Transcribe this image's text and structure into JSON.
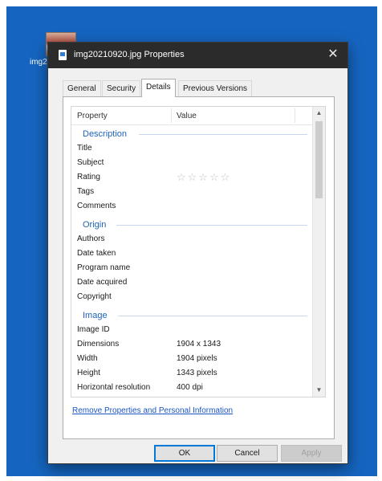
{
  "desktop": {
    "icon_label": "img2"
  },
  "dialog": {
    "title": "img20210920.jpg Properties",
    "close_glyph": "✕"
  },
  "tabs": [
    {
      "label": "General"
    },
    {
      "label": "Security"
    },
    {
      "label": "Details",
      "active": true
    },
    {
      "label": "Previous Versions"
    }
  ],
  "details": {
    "columns": {
      "property": "Property",
      "value": "Value"
    },
    "groups": {
      "description": "Description",
      "origin": "Origin",
      "image": "Image"
    },
    "description_rows": [
      {
        "property": "Title",
        "value": ""
      },
      {
        "property": "Subject",
        "value": ""
      },
      {
        "property": "Rating",
        "value": "☆☆☆☆☆"
      },
      {
        "property": "Tags",
        "value": ""
      },
      {
        "property": "Comments",
        "value": ""
      }
    ],
    "origin_rows": [
      {
        "property": "Authors",
        "value": ""
      },
      {
        "property": "Date taken",
        "value": ""
      },
      {
        "property": "Program name",
        "value": ""
      },
      {
        "property": "Date acquired",
        "value": ""
      },
      {
        "property": "Copyright",
        "value": ""
      }
    ],
    "image_rows": [
      {
        "property": "Image ID",
        "value": ""
      },
      {
        "property": "Dimensions",
        "value": "1904 x 1343"
      },
      {
        "property": "Width",
        "value": "1904 pixels"
      },
      {
        "property": "Height",
        "value": "1343 pixels"
      },
      {
        "property": "Horizontal resolution",
        "value": "400 dpi"
      }
    ],
    "scroll_up_glyph": "▲",
    "scroll_down_glyph": "▼",
    "remove_link": "Remove Properties and Personal Information"
  },
  "buttons": {
    "ok": "OK",
    "cancel": "Cancel",
    "apply": "Apply"
  },
  "colors": {
    "desktop": "#1565c0",
    "titlebar": "#2b2b2b",
    "group_heading": "#1e63b8",
    "link": "#1a56c4"
  }
}
